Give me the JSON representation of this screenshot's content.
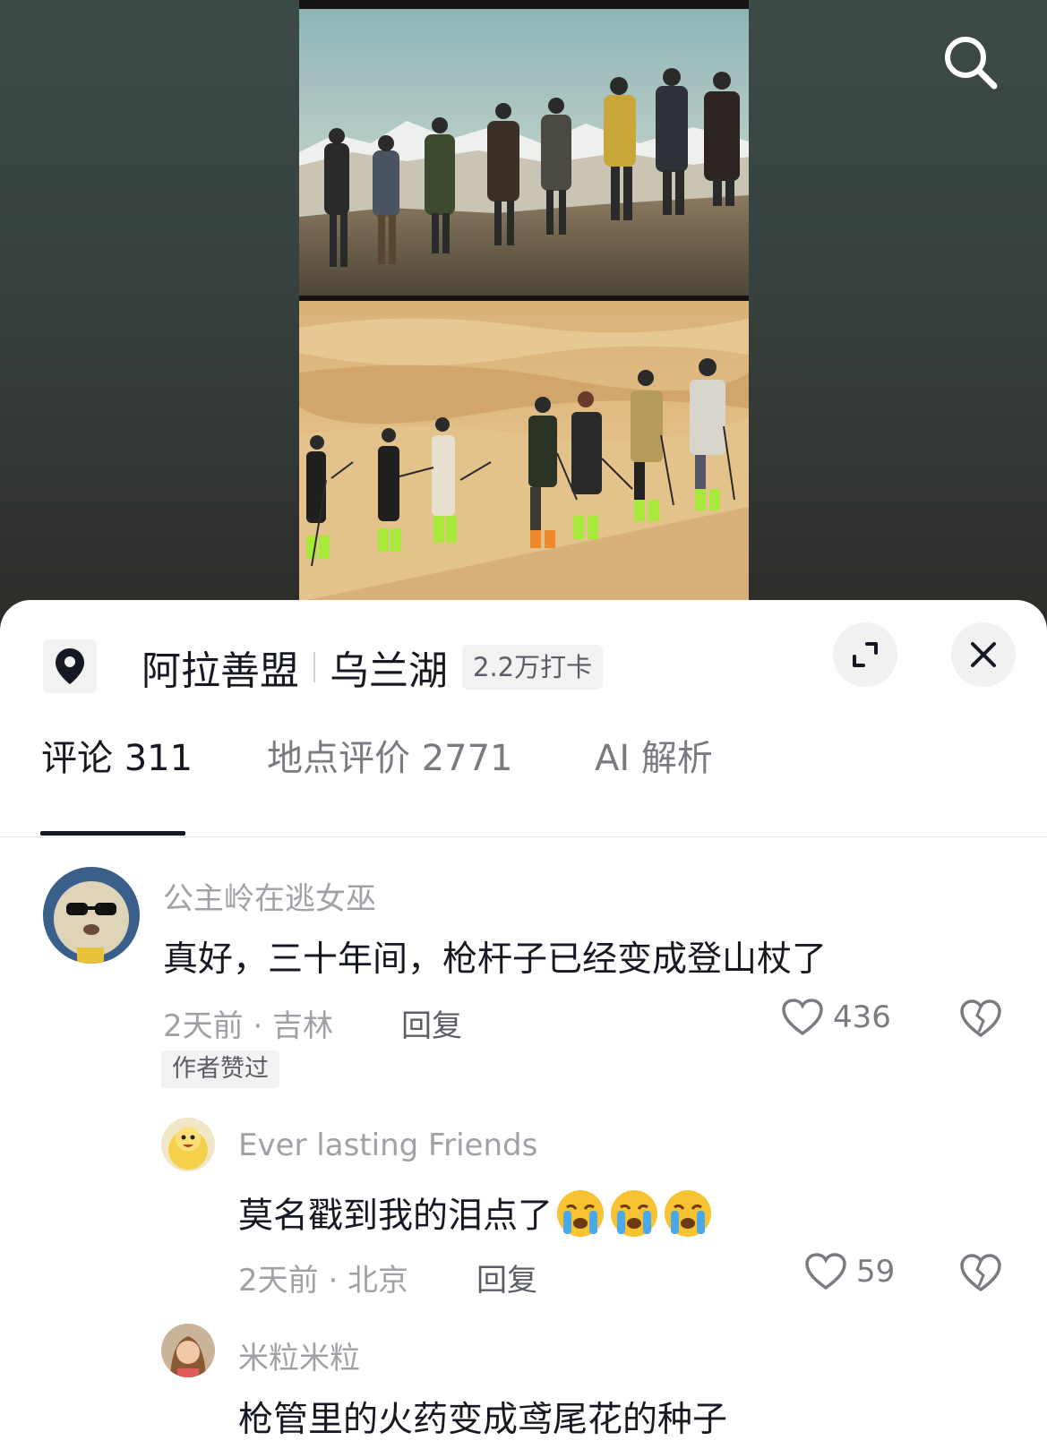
{
  "location": {
    "region": "阿拉善盟",
    "place": "乌兰湖",
    "checkins": "2.2万打卡"
  },
  "tabs": [
    {
      "label": "评论 311",
      "active": true
    },
    {
      "label": "地点评价 2771",
      "active": false
    },
    {
      "label": "AI 解析",
      "active": false
    }
  ],
  "comments": [
    {
      "username": "公主岭在逃女巫",
      "text": "真好，三十年间，枪杆子已经变成登山杖了",
      "meta": "2天前 · 吉林",
      "reply_label": "回复",
      "likes": "436",
      "badge": "作者赞过",
      "replies": [
        {
          "username": "Ever lasting Friends",
          "text": "莫名戳到我的泪点了",
          "emoji": "loudly-crying-face-icon",
          "emoji_count": 3,
          "meta": "2天前 · 北京",
          "reply_label": "回复",
          "likes": "59"
        },
        {
          "username": "米粒米粒",
          "text": "枪管里的火药变成鸢尾花的种子"
        }
      ]
    }
  ],
  "colors": {
    "primary_text": "#161823",
    "secondary_text": "#a0a1a6",
    "active_tab_indicator": "#161823",
    "sheet_background": "#ffffff"
  }
}
